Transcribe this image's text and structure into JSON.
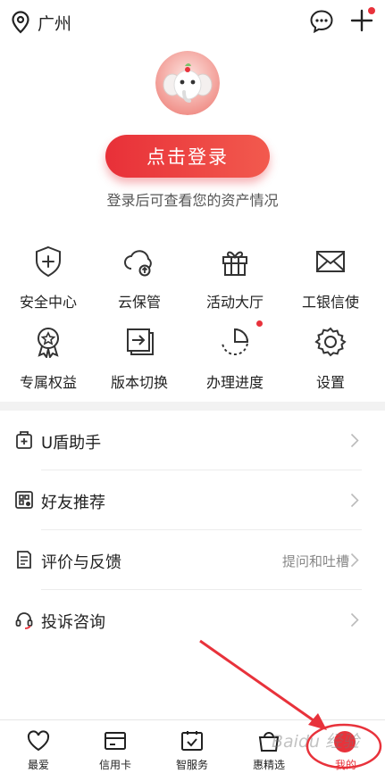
{
  "colors": {
    "accent": "#e8323b",
    "icon": "#333333",
    "text": "#222222",
    "hint": "#888888"
  },
  "header": {
    "city": "广州",
    "location_icon": "location-pin-icon",
    "message_icon": "chat-bubble-icon",
    "add_icon": "plus-icon"
  },
  "profile": {
    "avatar_icon": "elephant-avatar-icon",
    "login_label": "点击登录",
    "login_tip": "登录后可查看您的资产情况"
  },
  "grid": [
    {
      "label": "安全中心",
      "icon": "shield-plus-icon"
    },
    {
      "label": "云保管",
      "icon": "cloud-upload-icon"
    },
    {
      "label": "活动大厅",
      "icon": "gift-icon"
    },
    {
      "label": "工银信使",
      "icon": "envelope-icon"
    },
    {
      "label": "专属权益",
      "icon": "award-star-icon"
    },
    {
      "label": "版本切换",
      "icon": "switch-arrow-icon"
    },
    {
      "label": "办理进度",
      "icon": "progress-pie-icon"
    },
    {
      "label": "设置",
      "icon": "gear-icon"
    }
  ],
  "list": [
    {
      "label": "U盾助手",
      "icon": "usb-key-icon",
      "hint": ""
    },
    {
      "label": "好友推荐",
      "icon": "qr-share-icon",
      "hint": ""
    },
    {
      "label": "评价与反馈",
      "icon": "feedback-doc-icon",
      "hint": "提问和吐槽"
    },
    {
      "label": "投诉咨询",
      "icon": "headset-icon",
      "hint": ""
    }
  ],
  "tabs": [
    {
      "label": "最爱",
      "icon": "heart-icon"
    },
    {
      "label": "信用卡",
      "icon": "credit-card-icon"
    },
    {
      "label": "智服务",
      "icon": "calendar-check-icon"
    },
    {
      "label": "惠精选",
      "icon": "shopping-bag-icon"
    },
    {
      "label": "我的",
      "icon": "user-badge-icon",
      "active": true
    }
  ],
  "watermark": "Baidu 经验"
}
